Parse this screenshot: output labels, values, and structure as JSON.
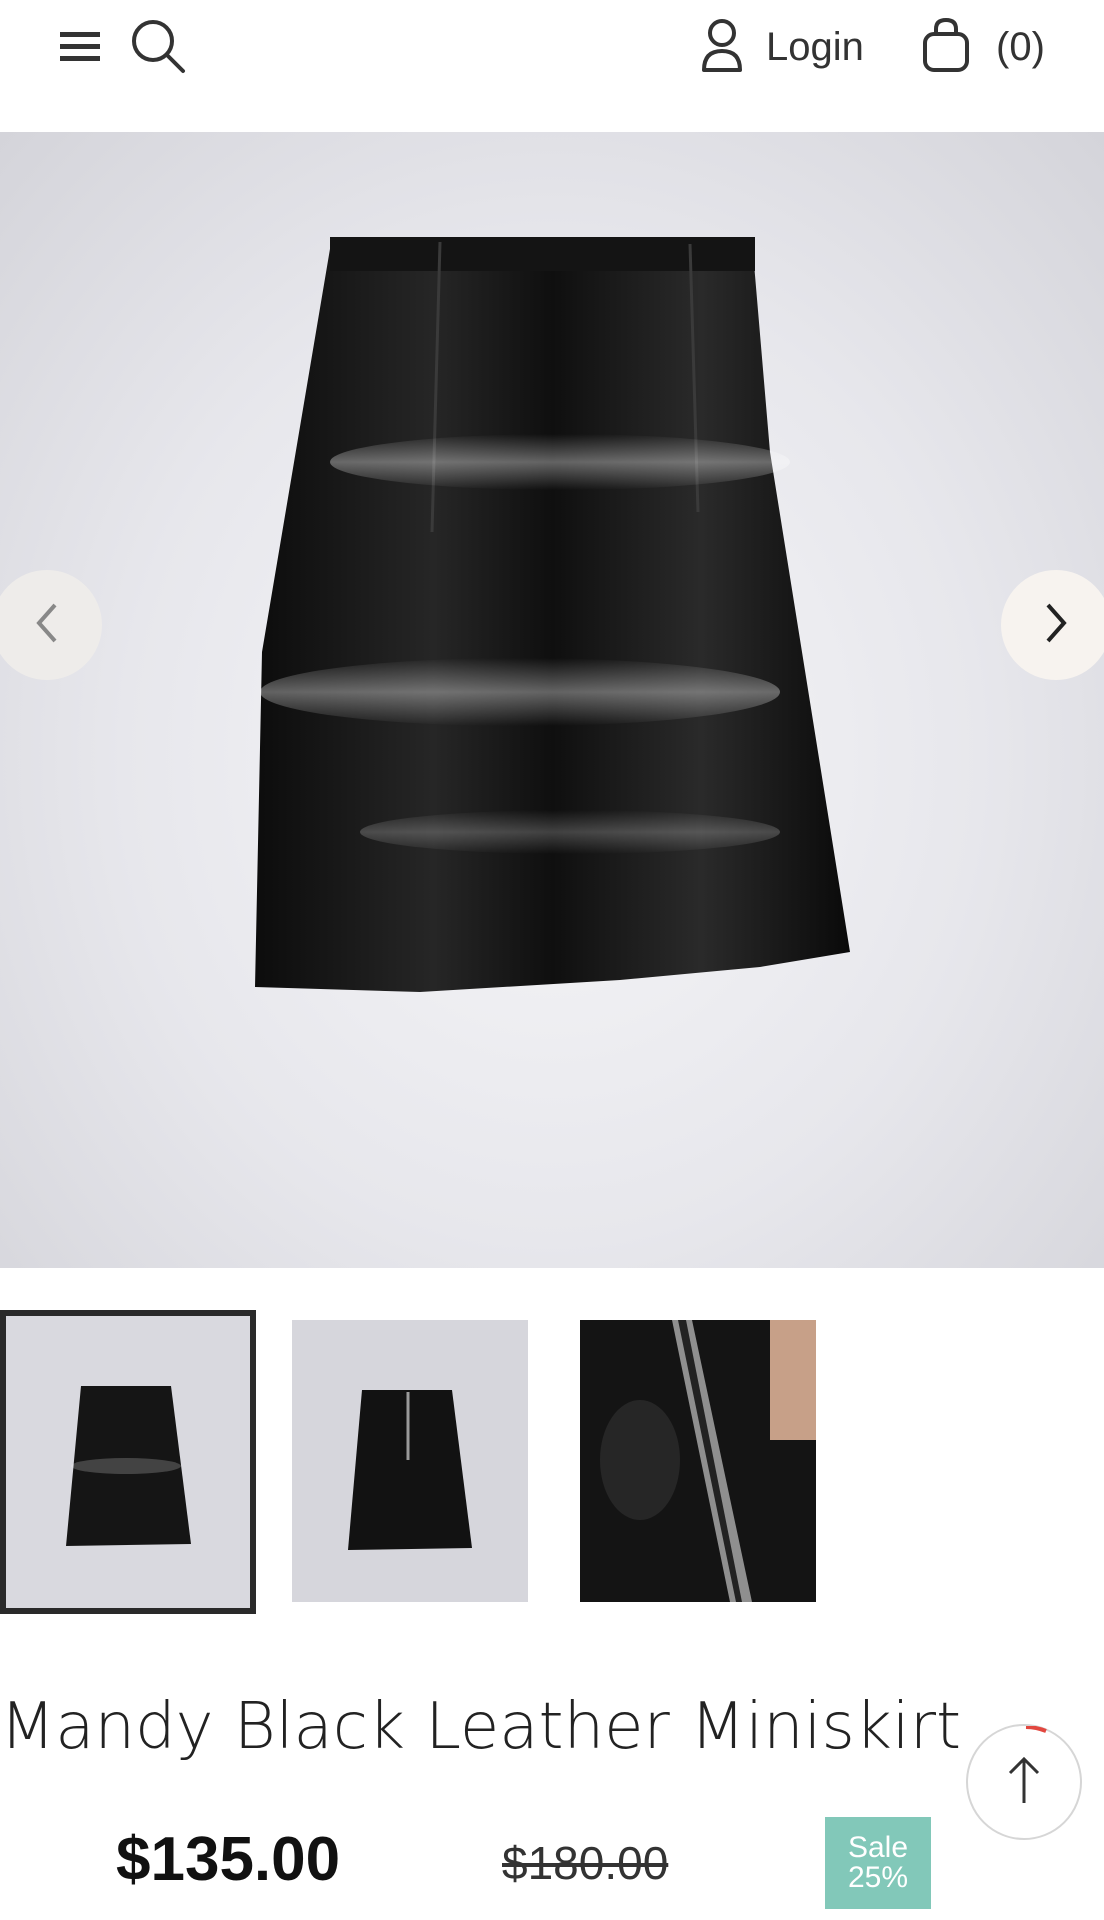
{
  "header": {
    "menu_icon": "hamburger-icon",
    "search_icon": "search-icon",
    "login_label": "Login",
    "cart_count": "(0)"
  },
  "gallery": {
    "prev_icon": "chevron-left-icon",
    "next_icon": "chevron-right-icon",
    "thumbnails": [
      "skirt-front",
      "skirt-back",
      "skirt-zipper-detail"
    ]
  },
  "product": {
    "title": "Mandy Black Leather Miniskirt",
    "price": "$135.00",
    "old_price": "$180.00",
    "sale_label": "Sale",
    "sale_percent": "25%"
  },
  "colors": {
    "sale_badge": "#82c8b9",
    "active_thumb_border": "#2a2a2a"
  }
}
